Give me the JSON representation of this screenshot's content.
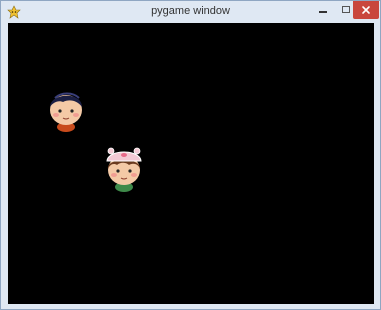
{
  "window": {
    "title": "pygame window",
    "buttons": {
      "minimize": "minimize",
      "maximize": "maximize",
      "close": "close"
    }
  },
  "canvas": {
    "background": "#000000"
  },
  "sprites": [
    {
      "name": "boy-head-icon",
      "hair": "#1b1f44",
      "shirt": "#c84b1c"
    },
    {
      "name": "girl-head-icon",
      "hair": "#6b3a1e",
      "hat": "#f3c9d4",
      "shirt": "#3f8a4a"
    }
  ],
  "colors": {
    "titlebar": "#dfe8f3",
    "close_button": "#c9463d"
  }
}
